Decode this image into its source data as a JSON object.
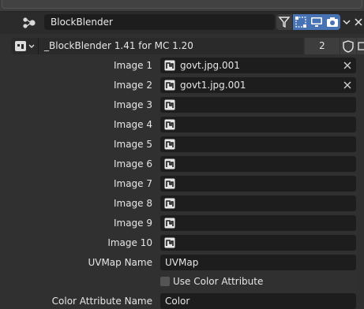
{
  "header": {
    "node_name": "BlockBlender",
    "icons": [
      "node-tree-icon",
      "filter-icon",
      "viewport-select-icon",
      "monitor-icon",
      "camera-icon",
      "chevron-down-icon",
      "close-icon"
    ]
  },
  "version_row": {
    "selector_icon": "node-group-icon",
    "value": "_BlockBlender 1.41 for MC 1.20",
    "users": "2"
  },
  "images": [
    {
      "label": "Image 1",
      "value": "govt.jpg.001"
    },
    {
      "label": "Image 2",
      "value": "govt1.jpg.001"
    },
    {
      "label": "Image 3",
      "value": ""
    },
    {
      "label": "Image 4",
      "value": ""
    },
    {
      "label": "Image 5",
      "value": ""
    },
    {
      "label": "Image 6",
      "value": ""
    },
    {
      "label": "Image 7",
      "value": ""
    },
    {
      "label": "Image 8",
      "value": ""
    },
    {
      "label": "Image 9",
      "value": ""
    },
    {
      "label": "Image 10",
      "value": ""
    }
  ],
  "uvmap": {
    "label": "UVMap Name",
    "value": "UVMap"
  },
  "use_color_attribute": {
    "label": "Use Color Attribute",
    "checked": false
  },
  "color_attribute": {
    "label": "Color Attribute Name",
    "value": "Color"
  },
  "colors": {
    "accent": "#4772b3",
    "bg": "#303030",
    "field": "#1d1d1d"
  }
}
